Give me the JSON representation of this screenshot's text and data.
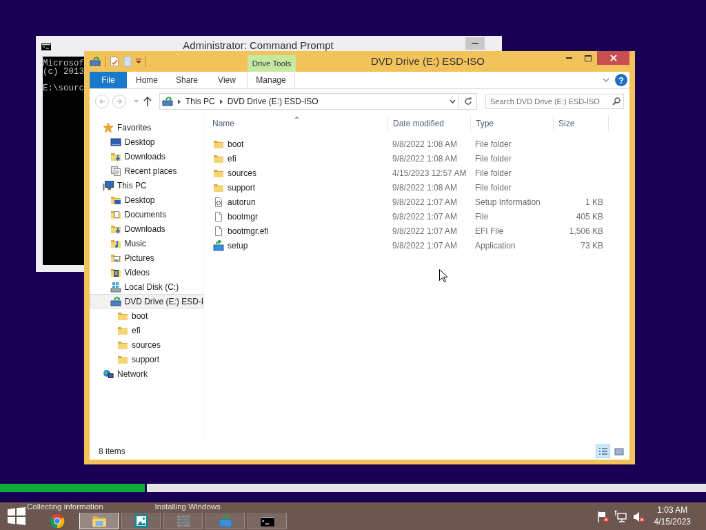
{
  "setup_progress": {
    "level": 0.205,
    "steps": [
      "Collecting information",
      "Installing Windows"
    ]
  },
  "cmd_window": {
    "title": "Administrator: Command Prompt",
    "lines": [
      "Microsof",
      "(c) 2013"
    ],
    "prompt": "E:\\sourc"
  },
  "explorer": {
    "title": "DVD Drive (E:) ESD-ISO",
    "context_tab": "Drive Tools",
    "tabs": [
      {
        "label": "File",
        "kind": "file",
        "selected": false
      },
      {
        "label": "Home",
        "kind": "tab",
        "selected": false
      },
      {
        "label": "Share",
        "kind": "tab",
        "selected": false
      },
      {
        "label": "View",
        "kind": "tab",
        "selected": false
      },
      {
        "label": "Manage",
        "kind": "context",
        "selected": false
      }
    ],
    "help": "?",
    "address": {
      "crumbs": [
        "This PC",
        "DVD Drive (E:) ESD-ISO"
      ]
    },
    "search": {
      "placeholder": "Search DVD Drive (E:) ESD-ISO"
    },
    "nav": [
      {
        "label": "Favorites",
        "kind": "star",
        "selected": false,
        "children": [
          {
            "label": "Desktop",
            "kind": "desktop",
            "selected": false
          },
          {
            "label": "Downloads",
            "kind": "downloads",
            "selected": false
          },
          {
            "label": "Recent places",
            "kind": "recent",
            "selected": false
          }
        ]
      },
      {
        "label": "This PC",
        "kind": "pc",
        "selected": false,
        "children": [
          {
            "label": "Desktop",
            "kind": "desktopfolder",
            "selected": false
          },
          {
            "label": "Documents",
            "kind": "documents",
            "selected": false
          },
          {
            "label": "Downloads",
            "kind": "downloads",
            "selected": false
          },
          {
            "label": "Music",
            "kind": "music",
            "selected": false
          },
          {
            "label": "Pictures",
            "kind": "pictures",
            "selected": false
          },
          {
            "label": "Videos",
            "kind": "videos",
            "selected": false
          },
          {
            "label": "Local Disk (C:)",
            "kind": "disk",
            "selected": false
          },
          {
            "label": "DVD Drive (E:) ESD-I",
            "kind": "dvd",
            "selected": true,
            "children": [
              {
                "label": "boot",
                "kind": "folder",
                "selected": false
              },
              {
                "label": "efi",
                "kind": "folder",
                "selected": false
              },
              {
                "label": "sources",
                "kind": "folder",
                "selected": false
              },
              {
                "label": "support",
                "kind": "folder",
                "selected": false
              }
            ]
          }
        ]
      },
      {
        "label": "Network",
        "kind": "network",
        "selected": false
      }
    ],
    "columns": [
      {
        "label": "Name",
        "sorted": true
      },
      {
        "label": "Date modified",
        "sorted": false
      },
      {
        "label": "Type",
        "sorted": false
      },
      {
        "label": "Size",
        "sorted": false
      }
    ],
    "rows": [
      {
        "name": "boot",
        "date": "9/8/2022 1:08 AM",
        "type": "File folder",
        "kind": "folder"
      },
      {
        "name": "efi",
        "date": "9/8/2022 1:08 AM",
        "type": "File folder",
        "kind": "folder"
      },
      {
        "name": "sources",
        "date": "4/15/2023 12:57 AM",
        "type": "File folder",
        "kind": "folder"
      },
      {
        "name": "support",
        "date": "9/8/2022 1:08 AM",
        "type": "File folder",
        "kind": "folder"
      },
      {
        "name": "autorun",
        "date": "9/8/2022 1:07 AM",
        "type": "Setup Information",
        "size": "1 KB",
        "kind": "settings"
      },
      {
        "name": "bootmgr",
        "date": "9/8/2022 1:07 AM",
        "type": "File",
        "size": "405 KB",
        "kind": "file"
      },
      {
        "name": "bootmgr.efi",
        "date": "9/8/2022 1:07 AM",
        "type": "EFI File",
        "size": "1,506 KB",
        "kind": "file"
      },
      {
        "name": "setup",
        "date": "9/8/2022 1:07 AM",
        "type": "Application",
        "size": "73 KB",
        "kind": "setup"
      }
    ],
    "status": "8 items",
    "views": [
      {
        "kind": "details",
        "selected": true
      },
      {
        "kind": "thumbnails",
        "selected": false
      }
    ]
  },
  "taskbar": {
    "apps": [
      {
        "kind": "chrome",
        "selected": false
      },
      {
        "kind": "explorer",
        "selected": true
      },
      {
        "kind": "photos",
        "selected": false
      },
      {
        "kind": "firewall",
        "selected": false
      },
      {
        "kind": "setup",
        "selected": false
      },
      {
        "kind": "cmd",
        "selected": false
      }
    ],
    "tray": [
      {
        "kind": "flag"
      },
      {
        "kind": "network"
      },
      {
        "kind": "speaker"
      }
    ],
    "time": "1:03 AM",
    "date": "4/15/2023"
  }
}
